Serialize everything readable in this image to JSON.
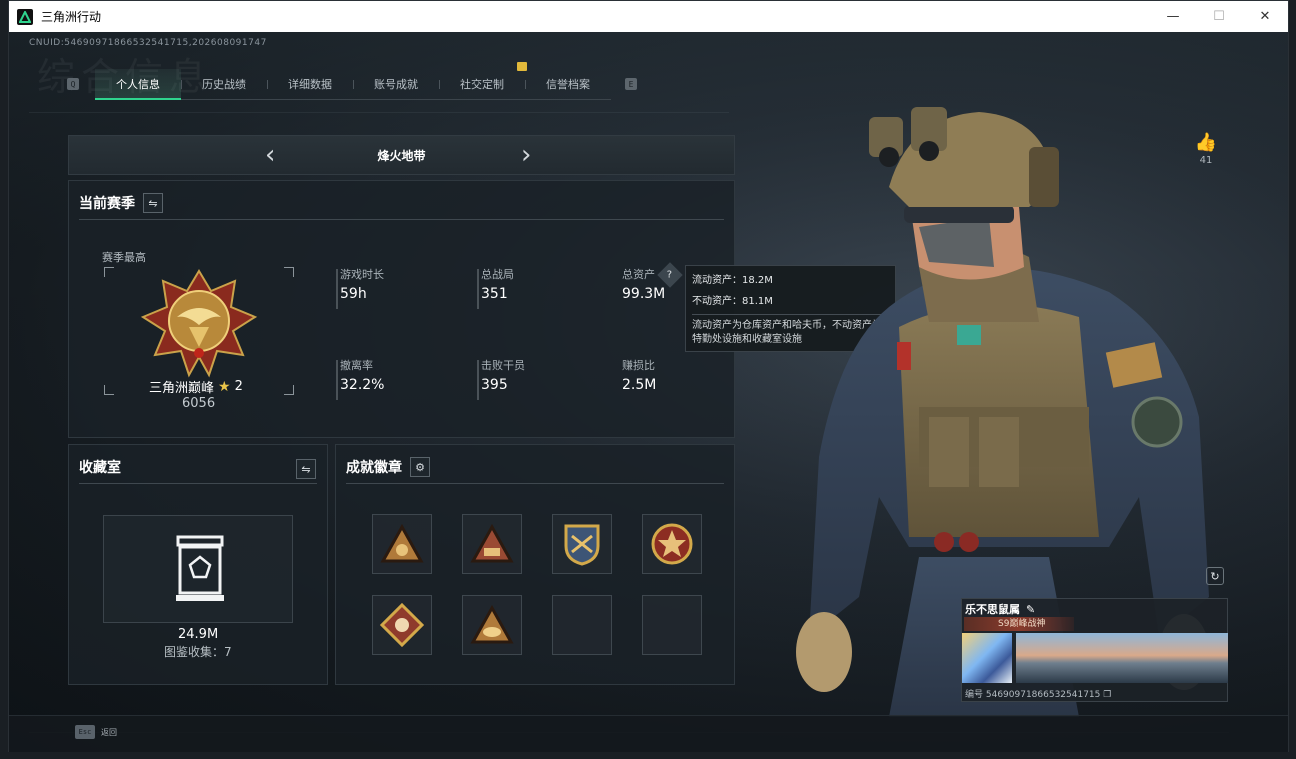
{
  "window": {
    "title": "三角洲行动"
  },
  "header": {
    "cnuid": "CNUID:5469097186653254171​5,2026080917​47",
    "ghost_title": "综合信息"
  },
  "tabs": {
    "left_key": "Q",
    "right_key": "E",
    "items": [
      {
        "label": "个人信息"
      },
      {
        "label": "历史战绩"
      },
      {
        "label": "详细数据"
      },
      {
        "label": "账号成就"
      },
      {
        "label": "社交定制"
      },
      {
        "label": "信誉档案"
      }
    ]
  },
  "mode": {
    "name": "烽火地带",
    "prev": "‹",
    "next": "›"
  },
  "season": {
    "title": "当前赛季",
    "best_label": "赛季最高",
    "rank_name": "三角洲巅峰",
    "rank_stars": "2",
    "rank_score": "6056",
    "stats": [
      {
        "label": "游戏时长",
        "value": "59h"
      },
      {
        "label": "总战局",
        "value": "351"
      },
      {
        "label": "总资产",
        "value": "99.3M"
      },
      {
        "label": "撤离率",
        "value": "32.2%"
      },
      {
        "label": "击败干员",
        "value": "395"
      },
      {
        "label": "赚损比",
        "value": "2.5M"
      }
    ],
    "help": "?"
  },
  "tooltip": {
    "liquid": "流动资产：18.2M",
    "fixed": "不动资产：81.1M",
    "note": "流动资产为仓库资产和哈夫币，不动资产为特勤处设施和收藏室设施"
  },
  "collection": {
    "title": "收藏室",
    "value": "24.9M",
    "count": "图鉴收集：7"
  },
  "badges": {
    "title": "成就徽章"
  },
  "likes": {
    "count": "41"
  },
  "card": {
    "nickname": "乐不思鼠属",
    "title": "S9巅峰战神",
    "uid": "编号 5469097186653254171​5"
  },
  "footer": {
    "esc_key": "Esc",
    "esc_label": "返回"
  },
  "colors": {
    "accent": "#2fd48e",
    "gold": "#e2b93b"
  }
}
